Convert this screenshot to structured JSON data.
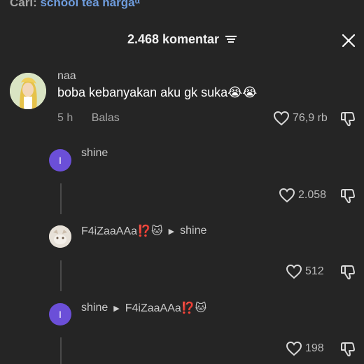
{
  "search": {
    "prefix": "Cari:",
    "term": "school tea harga",
    "caret": "α"
  },
  "header": {
    "title": "2.468 komentar"
  },
  "comment": {
    "username": "naa",
    "text": "boba kebanyakan aku gk suka😭😭",
    "time": "5 h",
    "reply_label": "Balas",
    "likes": "76,9 rb"
  },
  "replies": [
    {
      "username": "shine",
      "avatar_letter": "I",
      "likes": "2.058"
    },
    {
      "username": "F4iZaaAAa⁉️🐱",
      "reply_to": "shine",
      "likes": "512"
    },
    {
      "username": "shine",
      "avatar_letter": "I",
      "reply_to": "F4iZaaAAa⁉️🐱",
      "likes": "198"
    }
  ],
  "colors": {
    "background": "#252525",
    "accent_link": "#6f9dde",
    "avatar_purple": "#6b4fd8"
  }
}
